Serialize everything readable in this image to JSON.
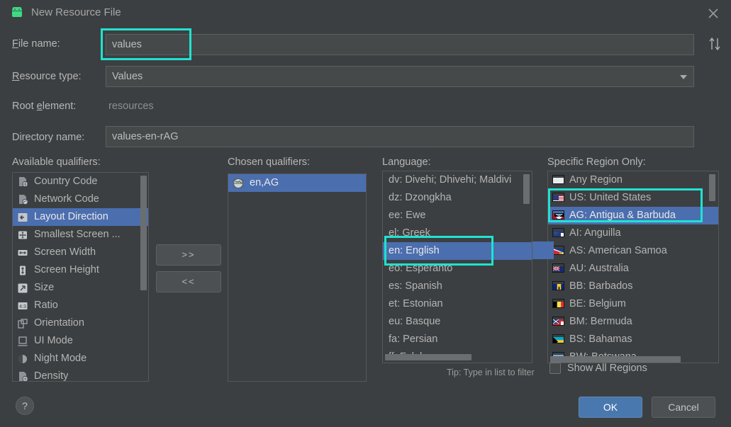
{
  "window": {
    "title": "New Resource File",
    "app_icon": "android-icon",
    "close_icon": "close-icon",
    "sort_icon": "sort-updown-icon"
  },
  "form": {
    "file_name": {
      "label": "File name:",
      "mnemonic": "F",
      "value": "values",
      "highlighted": true
    },
    "resource_type": {
      "label": "Resource type:",
      "mnemonic": "R",
      "value": "Values"
    },
    "root_element": {
      "label": "Root element:",
      "mnemonic": "e",
      "value": "resources"
    },
    "directory_name": {
      "label": "Directory name:",
      "value": "values-en-rAG"
    }
  },
  "available": {
    "heading": "Available qualifiers:",
    "mnemonic": "v",
    "items": [
      {
        "label": "Country Code",
        "icon": "country-code-icon",
        "selected": false
      },
      {
        "label": "Network Code",
        "icon": "network-code-icon",
        "selected": false
      },
      {
        "label": "Layout Direction",
        "icon": "layout-direction-icon",
        "selected": true
      },
      {
        "label": "Smallest Screen ...",
        "icon": "smallest-screen-icon",
        "selected": false
      },
      {
        "label": "Screen Width",
        "icon": "screen-width-icon",
        "selected": false
      },
      {
        "label": "Screen Height",
        "icon": "screen-height-icon",
        "selected": false
      },
      {
        "label": "Size",
        "icon": "size-icon",
        "selected": false
      },
      {
        "label": "Ratio",
        "icon": "ratio-icon",
        "selected": false
      },
      {
        "label": "Orientation",
        "icon": "orientation-icon",
        "selected": false
      },
      {
        "label": "UI Mode",
        "icon": "ui-mode-icon",
        "selected": false
      },
      {
        "label": "Night Mode",
        "icon": "night-mode-icon",
        "selected": false
      },
      {
        "label": "Density",
        "icon": "density-icon",
        "selected": false
      }
    ]
  },
  "move_buttons": {
    "add": ">>",
    "remove": "<<"
  },
  "chosen": {
    "heading": "Chosen qualifiers:",
    "mnemonic": "C",
    "items": [
      {
        "label": "en,AG",
        "icon": "globe-icon",
        "selected": true
      }
    ]
  },
  "language": {
    "heading": "Language:",
    "items": [
      {
        "label": "dv: Divehi; Dhivehi; Maldivi",
        "selected": false
      },
      {
        "label": "dz: Dzongkha",
        "selected": false
      },
      {
        "label": "ee: Ewe",
        "selected": false
      },
      {
        "label": "el: Greek",
        "selected": false
      },
      {
        "label": "en: English",
        "selected": true,
        "highlighted": true
      },
      {
        "label": "eo: Esperanto",
        "selected": false
      },
      {
        "label": "es: Spanish",
        "selected": false
      },
      {
        "label": "et: Estonian",
        "selected": false
      },
      {
        "label": "eu: Basque",
        "selected": false
      },
      {
        "label": "fa: Persian",
        "selected": false
      },
      {
        "label": "ff: Fulah",
        "selected": false
      }
    ],
    "tip": "Tip: Type in list to filter"
  },
  "region": {
    "heading": "Specific Region Only:",
    "items": [
      {
        "label": "Any Region",
        "flag": "blank-flag-icon",
        "selected": false
      },
      {
        "label": "US: United States",
        "flag": "us-flag-icon",
        "selected": false,
        "highlighted": true
      },
      {
        "label": "AG: Antigua & Barbuda",
        "flag": "ag-flag-icon",
        "selected": true,
        "highlighted": true
      },
      {
        "label": "AI: Anguilla",
        "flag": "ai-flag-icon",
        "selected": false
      },
      {
        "label": "AS: American Samoa",
        "flag": "as-flag-icon",
        "selected": false
      },
      {
        "label": "AU: Australia",
        "flag": "au-flag-icon",
        "selected": false
      },
      {
        "label": "BB: Barbados",
        "flag": "bb-flag-icon",
        "selected": false
      },
      {
        "label": "BE: Belgium",
        "flag": "be-flag-icon",
        "selected": false
      },
      {
        "label": "BM: Bermuda",
        "flag": "bm-flag-icon",
        "selected": false
      },
      {
        "label": "BS: Bahamas",
        "flag": "bs-flag-icon",
        "selected": false
      },
      {
        "label": "BW: Botswana",
        "flag": "bw-flag-icon",
        "selected": false
      }
    ],
    "show_all": {
      "label": "Show All Regions",
      "checked": false
    }
  },
  "footer": {
    "help": "?",
    "ok": "OK",
    "cancel": "Cancel"
  },
  "colors": {
    "window_bg": "#3c3f41",
    "field_bg": "#45494a",
    "selection_blue": "#4b6eaf",
    "highlight_cyan": "#1fe3d0",
    "ok_blue": "#4878ad",
    "android_green": "#3ddc84"
  }
}
